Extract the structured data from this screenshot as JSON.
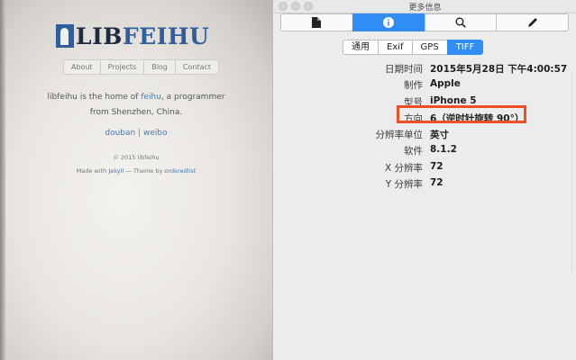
{
  "photo": {
    "logo": {
      "part1": "LIB",
      "part2": "FEIHU"
    },
    "nav": [
      "About",
      "Projects",
      "Blog",
      "Contact"
    ],
    "intro": {
      "pre": "libfeihu is the home of ",
      "link": "feihu",
      "post": ", a programmer",
      "line2": "from Shenzhen, China."
    },
    "social": {
      "douban": "douban",
      "sep": " | ",
      "weibo": "weibo"
    },
    "copyright": "© 2015 libfeihu",
    "credit": {
      "pre": "Made with ",
      "jekyll": "Jekyll",
      "mid": " — Theme by ",
      "theme": "orderedlist"
    }
  },
  "window": {
    "title": "更多信息",
    "toolbar": [
      {
        "icon": "document-icon"
      },
      {
        "icon": "info-icon",
        "active": true
      },
      {
        "icon": "search-icon"
      },
      {
        "icon": "pencil-icon"
      }
    ],
    "tabs": [
      {
        "label": "通用"
      },
      {
        "label": "Exif"
      },
      {
        "label": "GPS"
      },
      {
        "label": "TIFF",
        "active": true
      }
    ],
    "rows": [
      {
        "key": "日期时间",
        "value": "2015年5月28日 下午4:00:57"
      },
      {
        "key": "制作",
        "value": "Apple"
      },
      {
        "key": "型号",
        "value": "iPhone 5"
      },
      {
        "key": "方向",
        "value": "6（逆时针旋转 90°）"
      },
      {
        "key": "分辨率单位",
        "value": "英寸"
      },
      {
        "key": "软件",
        "value": "8.1.2"
      },
      {
        "key": "X 分辨率",
        "value": "72"
      },
      {
        "key": "Y 分辨率",
        "value": "72"
      }
    ],
    "highlight_color": "#f04e24",
    "accent_color": "#2f8df3"
  }
}
